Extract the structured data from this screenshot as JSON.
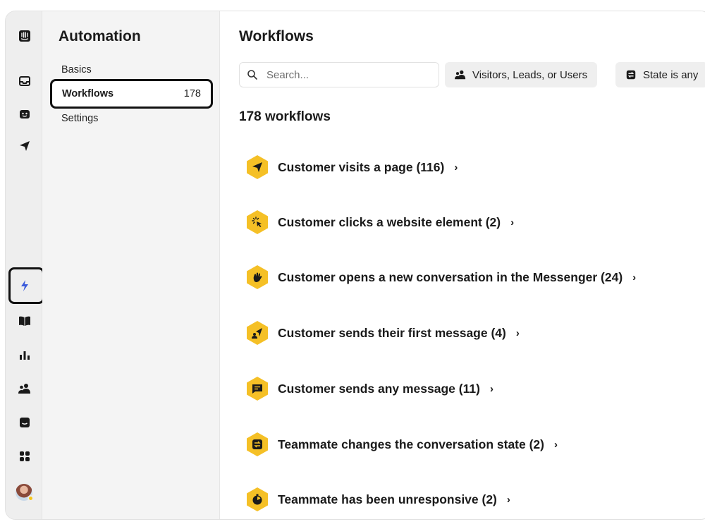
{
  "colors": {
    "accent_yellow": "#f5c026",
    "active_icon_blue": "#3b5bdb",
    "text_primary": "#1a1a1a"
  },
  "rail": {
    "icons": [
      "intercom-logo-icon",
      "inbox-icon",
      "bot-icon",
      "outbound-send-icon",
      "automation-bolt-icon",
      "articles-book-icon",
      "reports-chart-icon",
      "contacts-people-icon",
      "messenger-icon",
      "apps-grid-icon",
      "user-avatar"
    ]
  },
  "subnav": {
    "title": "Automation",
    "basics": "Basics",
    "workflows_label": "Workflows",
    "workflows_count": "178",
    "settings": "Settings"
  },
  "main": {
    "title": "Workflows",
    "search_placeholder": "Search...",
    "filter_audience": "Visitors, Leads, or Users",
    "filter_state": "State is any",
    "count_heading": "178 workflows",
    "chevron": "›",
    "triggers": [
      {
        "label": "Customer visits a page (116)",
        "icon": "send-plane-icon"
      },
      {
        "label": "Customer clicks a website element (2)",
        "icon": "click-cursor-icon"
      },
      {
        "label": "Customer opens a new conversation in the Messenger (24)",
        "icon": "wave-hand-icon"
      },
      {
        "label": "Customer sends their first message (4)",
        "icon": "first-message-icon"
      },
      {
        "label": "Customer sends any message (11)",
        "icon": "chat-bubble-icon"
      },
      {
        "label": "Teammate changes the conversation state (2)",
        "icon": "state-change-icon"
      },
      {
        "label": "Teammate has been unresponsive (2)",
        "icon": "timer-icon"
      }
    ]
  }
}
